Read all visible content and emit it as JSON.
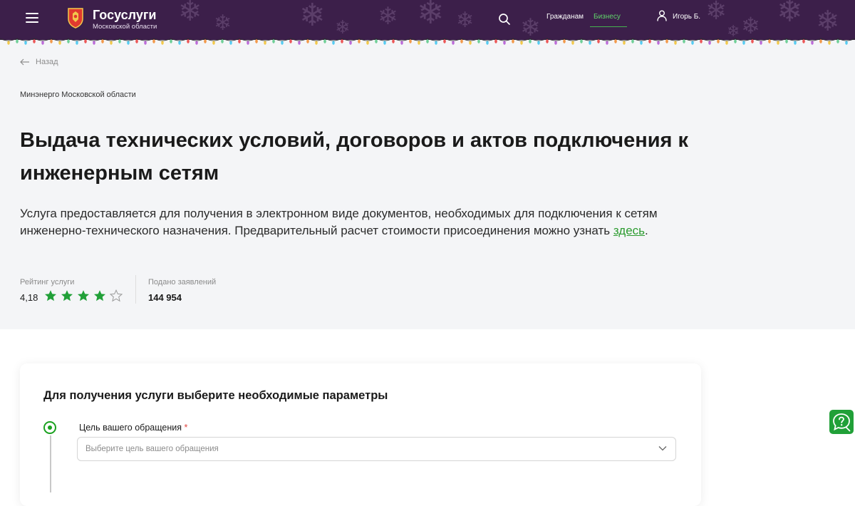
{
  "header": {
    "logo_title": "Госуслуги",
    "logo_subtitle": "Московской области",
    "nav": {
      "citizens": "Гражданам",
      "business": "Бизнесу"
    },
    "user_name": "Игорь Б.",
    "background_color": "#3c1f4a",
    "accent_color": "#5fd36a"
  },
  "back_label": "Назад",
  "agency": "Минэнерго Московской области",
  "service": {
    "title": "Выдача технических условий, договоров и актов подключения к инженерным сетям",
    "description_text": "Услуга предоставляется для получения в электронном виде документов, необходимых для подключения к сетям инженерно-технического назначения. Предварительный расчет стоимости присоединения можно узнать ",
    "description_link": "здесь",
    "description_end": "."
  },
  "stats": {
    "rating_label": "Рейтинг услуги",
    "rating_value": "4,18",
    "stars_filled": 4,
    "stars_total": 5,
    "applications_label": "Подано заявлений",
    "applications_value": "144 954"
  },
  "params": {
    "title": "Для получения услуги выберите необходимые параметры",
    "field_label": "Цель вашего обращения",
    "required_mark": "*",
    "placeholder": "Выберите цель вашего обращения"
  },
  "icons": {
    "menu": "menu-icon",
    "search": "search-icon",
    "user": "user-icon",
    "back": "arrow-left-icon",
    "chevron": "chevron-down-icon",
    "help": "chat-question-icon"
  }
}
